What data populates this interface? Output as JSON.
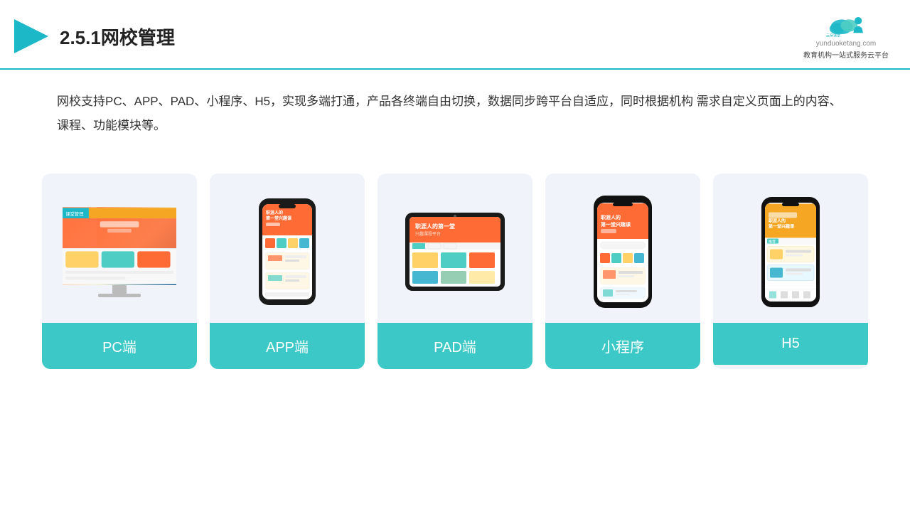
{
  "header": {
    "title": "2.5.1网校管理",
    "logo_url": "yunduoketang.com",
    "logo_slogan": "教育机构一站\n式服务云平台"
  },
  "description": "网校支持PC、APP、PAD、小程序、H5，实现多端打通，产品各终端自由切换，数据同步跨平台自适应，同时根据机构\n需求自定义页面上的内容、课程、功能模块等。",
  "cards": [
    {
      "id": "pc",
      "label": "PC端"
    },
    {
      "id": "app",
      "label": "APP端"
    },
    {
      "id": "pad",
      "label": "PAD端"
    },
    {
      "id": "miniprogram",
      "label": "小程序"
    },
    {
      "id": "h5",
      "label": "H5"
    }
  ]
}
